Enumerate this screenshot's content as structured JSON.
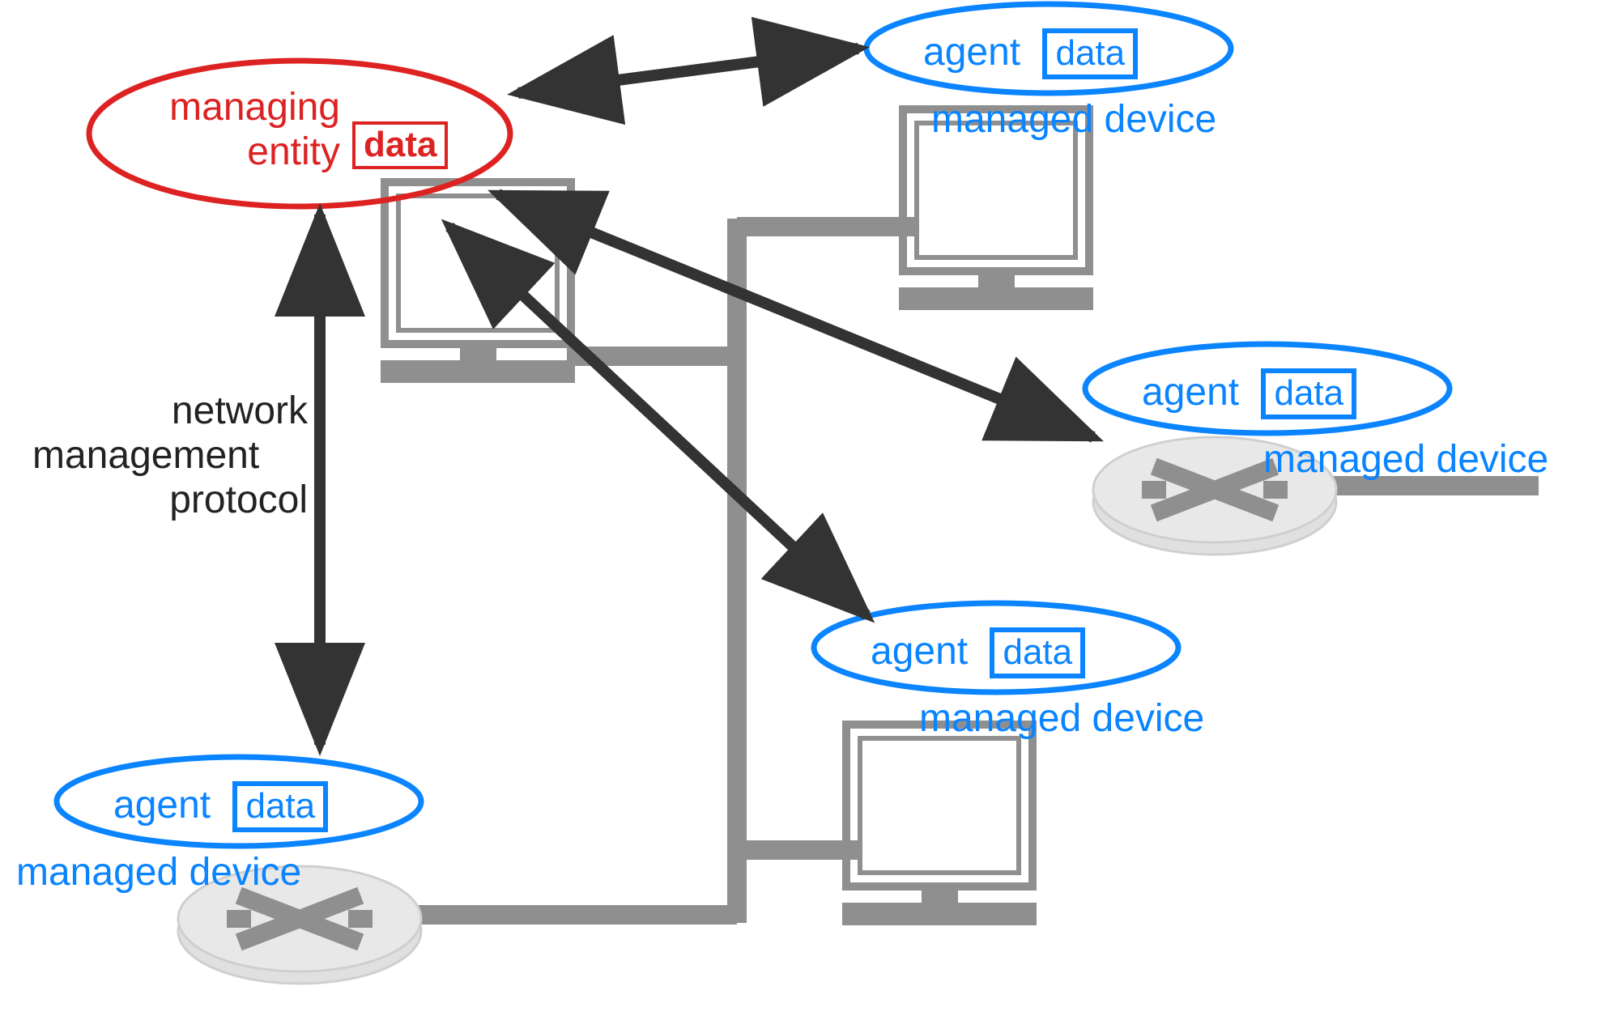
{
  "manager": {
    "line1": "managing",
    "line2": "entity",
    "data": "data"
  },
  "agents": [
    {
      "agent_label": "agent",
      "data_label": "data",
      "device_label": "managed device"
    },
    {
      "agent_label": "agent",
      "data_label": "data",
      "device_label": "managed device"
    },
    {
      "agent_label": "agent",
      "data_label": "data",
      "device_label": "managed device"
    },
    {
      "agent_label": "agent",
      "data_label": "data",
      "device_label": "managed device"
    }
  ],
  "protocol_label": {
    "line1": "network",
    "line2": "management",
    "line3": "protocol"
  },
  "colors": {
    "red": "#d22",
    "blue": "#0a84ff",
    "gray_dark": "#8f8f8f",
    "gray_light": "#cfcfcf",
    "black": "#333"
  }
}
